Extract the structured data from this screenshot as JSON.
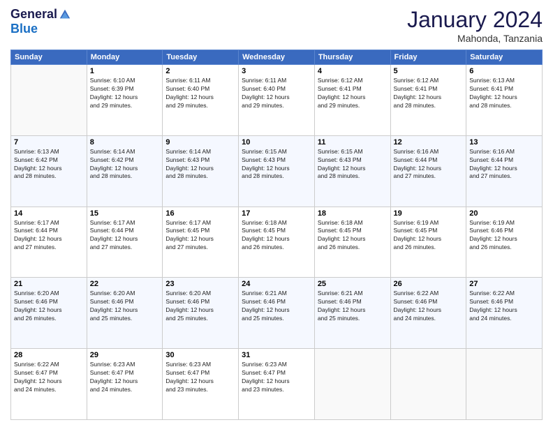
{
  "logo": {
    "general": "General",
    "blue": "Blue"
  },
  "header": {
    "month": "January 2024",
    "location": "Mahonda, Tanzania"
  },
  "weekdays": [
    "Sunday",
    "Monday",
    "Tuesday",
    "Wednesday",
    "Thursday",
    "Friday",
    "Saturday"
  ],
  "weeks": [
    [
      {
        "day": "",
        "info": ""
      },
      {
        "day": "1",
        "info": "Sunrise: 6:10 AM\nSunset: 6:39 PM\nDaylight: 12 hours\nand 29 minutes."
      },
      {
        "day": "2",
        "info": "Sunrise: 6:11 AM\nSunset: 6:40 PM\nDaylight: 12 hours\nand 29 minutes."
      },
      {
        "day": "3",
        "info": "Sunrise: 6:11 AM\nSunset: 6:40 PM\nDaylight: 12 hours\nand 29 minutes."
      },
      {
        "day": "4",
        "info": "Sunrise: 6:12 AM\nSunset: 6:41 PM\nDaylight: 12 hours\nand 29 minutes."
      },
      {
        "day": "5",
        "info": "Sunrise: 6:12 AM\nSunset: 6:41 PM\nDaylight: 12 hours\nand 28 minutes."
      },
      {
        "day": "6",
        "info": "Sunrise: 6:13 AM\nSunset: 6:41 PM\nDaylight: 12 hours\nand 28 minutes."
      }
    ],
    [
      {
        "day": "7",
        "info": "Sunrise: 6:13 AM\nSunset: 6:42 PM\nDaylight: 12 hours\nand 28 minutes."
      },
      {
        "day": "8",
        "info": "Sunrise: 6:14 AM\nSunset: 6:42 PM\nDaylight: 12 hours\nand 28 minutes."
      },
      {
        "day": "9",
        "info": "Sunrise: 6:14 AM\nSunset: 6:43 PM\nDaylight: 12 hours\nand 28 minutes."
      },
      {
        "day": "10",
        "info": "Sunrise: 6:15 AM\nSunset: 6:43 PM\nDaylight: 12 hours\nand 28 minutes."
      },
      {
        "day": "11",
        "info": "Sunrise: 6:15 AM\nSunset: 6:43 PM\nDaylight: 12 hours\nand 28 minutes."
      },
      {
        "day": "12",
        "info": "Sunrise: 6:16 AM\nSunset: 6:44 PM\nDaylight: 12 hours\nand 27 minutes."
      },
      {
        "day": "13",
        "info": "Sunrise: 6:16 AM\nSunset: 6:44 PM\nDaylight: 12 hours\nand 27 minutes."
      }
    ],
    [
      {
        "day": "14",
        "info": "Sunrise: 6:17 AM\nSunset: 6:44 PM\nDaylight: 12 hours\nand 27 minutes."
      },
      {
        "day": "15",
        "info": "Sunrise: 6:17 AM\nSunset: 6:44 PM\nDaylight: 12 hours\nand 27 minutes."
      },
      {
        "day": "16",
        "info": "Sunrise: 6:17 AM\nSunset: 6:45 PM\nDaylight: 12 hours\nand 27 minutes."
      },
      {
        "day": "17",
        "info": "Sunrise: 6:18 AM\nSunset: 6:45 PM\nDaylight: 12 hours\nand 26 minutes."
      },
      {
        "day": "18",
        "info": "Sunrise: 6:18 AM\nSunset: 6:45 PM\nDaylight: 12 hours\nand 26 minutes."
      },
      {
        "day": "19",
        "info": "Sunrise: 6:19 AM\nSunset: 6:45 PM\nDaylight: 12 hours\nand 26 minutes."
      },
      {
        "day": "20",
        "info": "Sunrise: 6:19 AM\nSunset: 6:46 PM\nDaylight: 12 hours\nand 26 minutes."
      }
    ],
    [
      {
        "day": "21",
        "info": "Sunrise: 6:20 AM\nSunset: 6:46 PM\nDaylight: 12 hours\nand 26 minutes."
      },
      {
        "day": "22",
        "info": "Sunrise: 6:20 AM\nSunset: 6:46 PM\nDaylight: 12 hours\nand 25 minutes."
      },
      {
        "day": "23",
        "info": "Sunrise: 6:20 AM\nSunset: 6:46 PM\nDaylight: 12 hours\nand 25 minutes."
      },
      {
        "day": "24",
        "info": "Sunrise: 6:21 AM\nSunset: 6:46 PM\nDaylight: 12 hours\nand 25 minutes."
      },
      {
        "day": "25",
        "info": "Sunrise: 6:21 AM\nSunset: 6:46 PM\nDaylight: 12 hours\nand 25 minutes."
      },
      {
        "day": "26",
        "info": "Sunrise: 6:22 AM\nSunset: 6:46 PM\nDaylight: 12 hours\nand 24 minutes."
      },
      {
        "day": "27",
        "info": "Sunrise: 6:22 AM\nSunset: 6:46 PM\nDaylight: 12 hours\nand 24 minutes."
      }
    ],
    [
      {
        "day": "28",
        "info": "Sunrise: 6:22 AM\nSunset: 6:47 PM\nDaylight: 12 hours\nand 24 minutes."
      },
      {
        "day": "29",
        "info": "Sunrise: 6:23 AM\nSunset: 6:47 PM\nDaylight: 12 hours\nand 24 minutes."
      },
      {
        "day": "30",
        "info": "Sunrise: 6:23 AM\nSunset: 6:47 PM\nDaylight: 12 hours\nand 23 minutes."
      },
      {
        "day": "31",
        "info": "Sunrise: 6:23 AM\nSunset: 6:47 PM\nDaylight: 12 hours\nand 23 minutes."
      },
      {
        "day": "",
        "info": ""
      },
      {
        "day": "",
        "info": ""
      },
      {
        "day": "",
        "info": ""
      }
    ]
  ]
}
